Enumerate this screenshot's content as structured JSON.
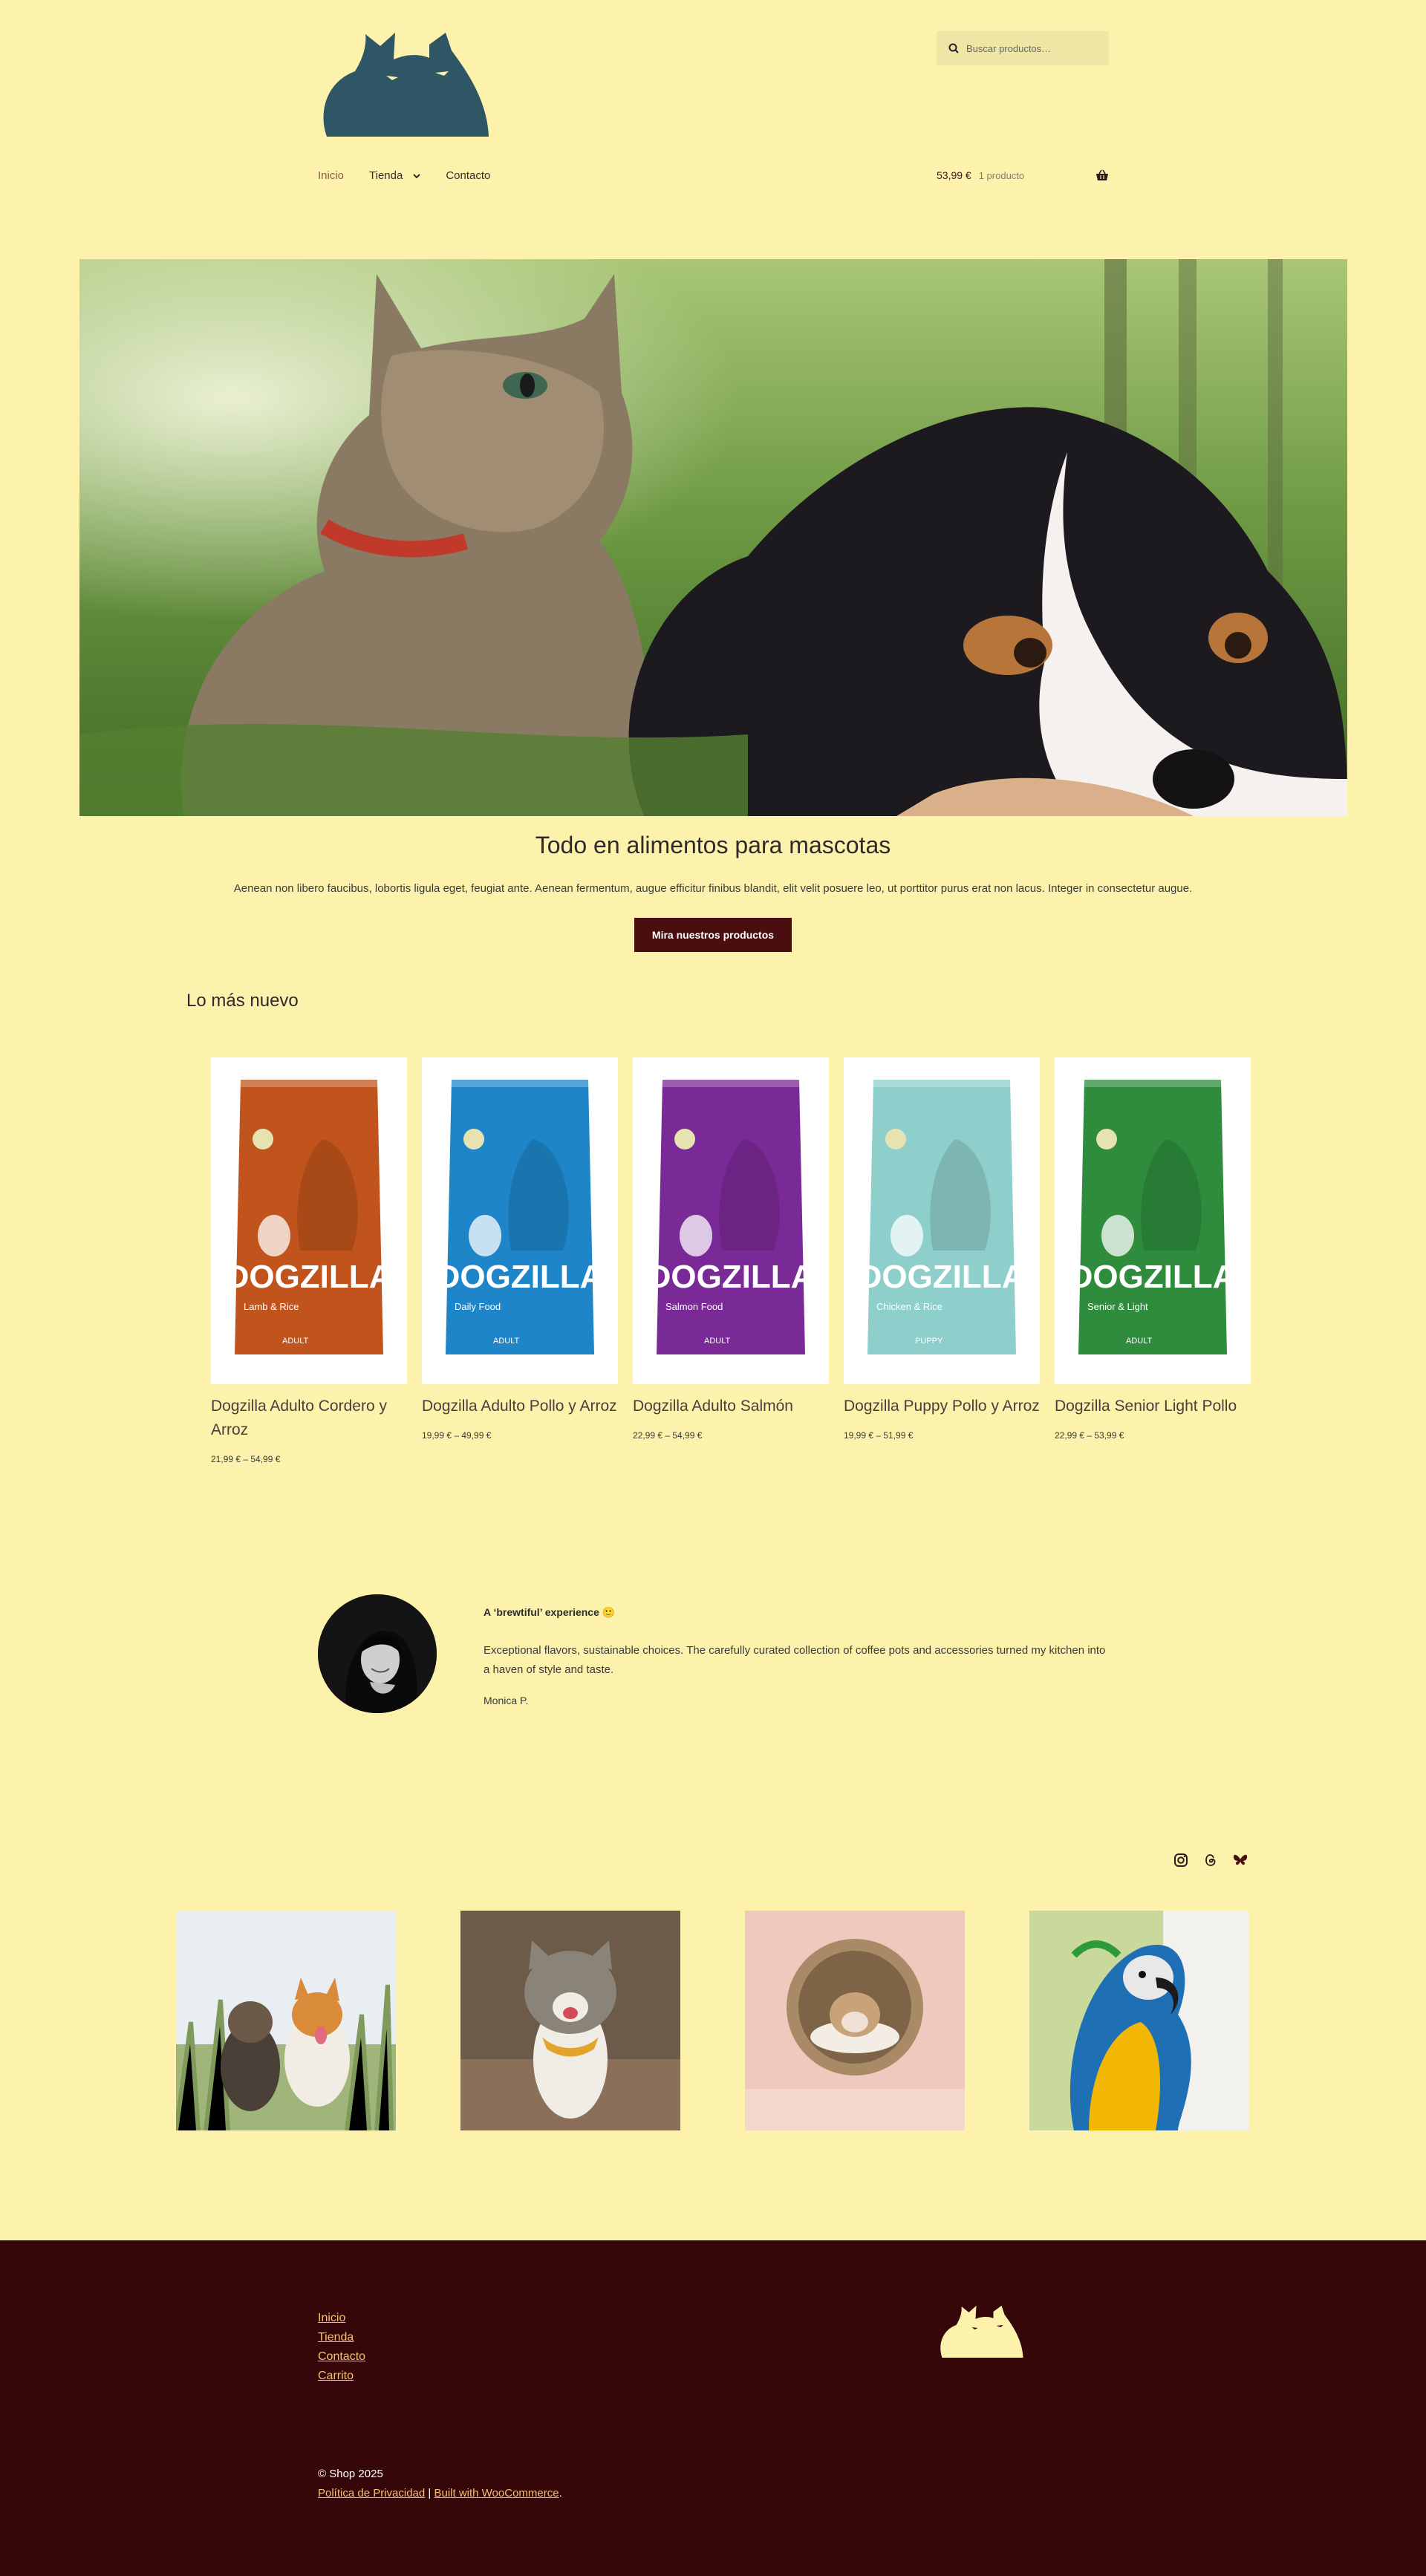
{
  "header": {
    "search_placeholder": "Buscar productos…"
  },
  "nav": {
    "items": [
      "Inicio",
      "Tienda",
      "Contacto"
    ]
  },
  "cart": {
    "amount": "53,99 €",
    "count": "1 producto"
  },
  "hero": {
    "title": "Todo en alimentos para mascotas",
    "text": "Aenean non libero faucibus, lobortis ligula eget, feugiat ante. Aenean fermentum, augue efficitur finibus blandit, elit velit posuere leo, ut porttitor purus erat non lacus. Integer in consectetur augue.",
    "button": "Mira nuestros productos"
  },
  "newest_heading": "Lo más nuevo",
  "products": [
    {
      "name": "Dogzilla Adulto Cordero y Arroz",
      "price": "21,99 € – 54,99 €",
      "bag_color": "#c0541c",
      "variant": "Lamb & Rice",
      "badge": "ADULT"
    },
    {
      "name": "Dogzilla Adulto Pollo y Arroz",
      "price": "19,99 € – 49,99 €",
      "bag_color": "#1e86c8",
      "variant": "Daily Food",
      "badge": "ADULT"
    },
    {
      "name": "Dogzilla Adulto Salmón",
      "price": "22,99 € – 54,99 €",
      "bag_color": "#7a2a96",
      "variant": "Salmon Food",
      "badge": "ADULT"
    },
    {
      "name": "Dogzilla Puppy Pollo y Arroz",
      "price": "19,99 € – 51,99 €",
      "bag_color": "#8fcfcb",
      "variant": "Chicken & Rice",
      "badge": "PUPPY"
    },
    {
      "name": "Dogzilla Senior Light Pollo",
      "price": "22,99 € – 53,99 €",
      "bag_color": "#2e8c3c",
      "variant": "Senior & Light",
      "badge": "ADULT"
    }
  ],
  "bag_brand": "DOGZILLA",
  "testimonial": {
    "title": "A ‘brewtiful’ experience 🙂",
    "quote": "Exceptional flavors, sustainable choices. The carefully curated collection of coffee pots and accessories turned my kitchen into a haven of style and taste.",
    "author": "Monica P."
  },
  "social_icons": [
    "instagram-icon",
    "threads-icon",
    "bluesky-icon"
  ],
  "footer": {
    "links": [
      "Inicio",
      "Tienda",
      "Contacto",
      "Carrito"
    ],
    "copyright": "© Shop 2025",
    "privacy": "Política de Privacidad",
    "separator": " | ",
    "built": "Built with WooCommerce",
    "period": "."
  },
  "colors": {
    "background": "#fdf2ab",
    "button": "#4a0d10",
    "footer_bg": "#350709",
    "footer_link": "#f5c16c",
    "logo": "#2e5664"
  }
}
